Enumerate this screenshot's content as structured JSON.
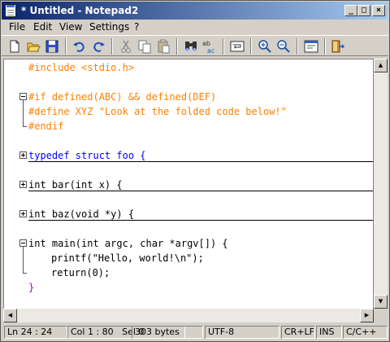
{
  "window": {
    "title": "* Untitled - Notepad2"
  },
  "titlebar": {
    "minimize": "_",
    "maximize": "□",
    "close": "×"
  },
  "menu": {
    "items": [
      "File",
      "Edit",
      "View",
      "Settings",
      "?"
    ]
  },
  "toolbar": {
    "buttons": [
      "new-file-icon",
      "open-folder-icon",
      "save-icon",
      "undo-icon",
      "redo-icon",
      "cut-icon",
      "copy-icon",
      "paste-icon",
      "find-icon",
      "replace-icon",
      "word-wrap-icon",
      "zoom-in-icon",
      "zoom-out-icon",
      "view-schemes-icon",
      "exit-icon"
    ]
  },
  "editor": {
    "lines": [
      "#include <stdio.h>",
      "#if defined(ABC) && defined(DEF)",
      "#define XYZ \"Look at the folded code below!\"",
      "#endif",
      "typedef struct foo {",
      "int bar(int x) {",
      "int baz(void *y) {",
      "int main(int argc, char *argv[]) {",
      "printf(\"Hello, world!\\n\");",
      "return(0);",
      "}"
    ]
  },
  "status": {
    "position": "Ln 24 : 24",
    "column": "Col 1 : 80",
    "selection": "Sel 0",
    "size": "303 bytes",
    "encoding": "UTF-8",
    "line_endings": "CR+LF",
    "insert_mode": "INS",
    "language": "C/C++"
  }
}
